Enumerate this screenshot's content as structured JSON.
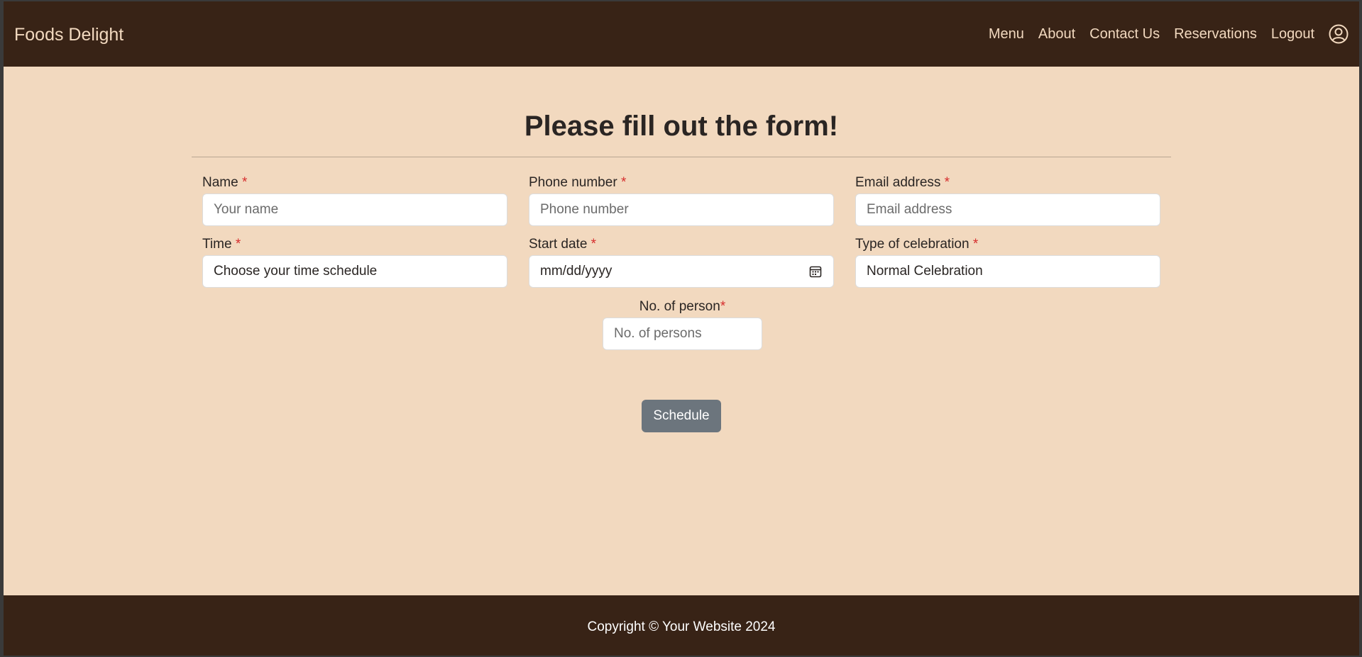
{
  "colors": {
    "nav_bg": "#382316",
    "page_bg": "#f2d9bf",
    "nav_text": "#f2d9bf",
    "required_star": "#d62d2d",
    "button_bg": "#6c757d"
  },
  "navbar": {
    "brand": "Foods Delight",
    "links": [
      "Menu",
      "About",
      "Contact Us",
      "Reservations",
      "Logout"
    ],
    "user_icon": "user-circle-icon"
  },
  "form": {
    "heading": "Please fill out the form!",
    "required_mark": "*",
    "name": {
      "label": "Name",
      "placeholder": "Your name"
    },
    "phone": {
      "label": "Phone number",
      "placeholder": "Phone number"
    },
    "email": {
      "label": "Email address",
      "placeholder": "Email address"
    },
    "time": {
      "label": "Time",
      "value": "Choose your time schedule"
    },
    "start_date": {
      "label": "Start date",
      "value": "mm/dd/yyyy",
      "icon": "calendar-icon"
    },
    "celebration": {
      "label": "Type of celebration",
      "value": "Normal Celebration"
    },
    "persons": {
      "label": "No. of person",
      "placeholder": "No. of persons"
    },
    "submit_label": "Schedule"
  },
  "footer": {
    "text": "Copyright © Your Website 2024"
  }
}
